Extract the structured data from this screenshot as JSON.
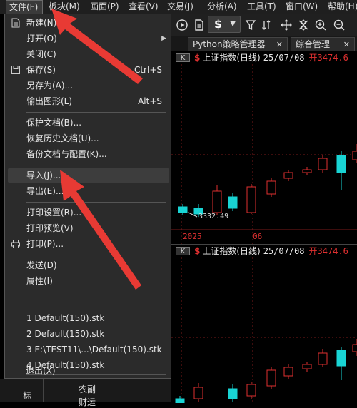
{
  "menubar": {
    "items": [
      "文件(F)",
      "板块(M)",
      "画面(P)",
      "查看(V)",
      "交易(J)",
      "分析(A)",
      "工具(T)",
      "窗口(W)",
      "帮助(H)"
    ]
  },
  "toolbar": {
    "dollar_label": "$",
    "icons": [
      "play-circle-icon",
      "document-icon",
      "chart-dollar-icon",
      "filter-icon",
      "sort-icon",
      "move-icon",
      "crossing-icon",
      "zoom-in-icon",
      "zoom-out-icon"
    ]
  },
  "tabs": [
    {
      "label": "Python策略管理器",
      "close": "✕"
    },
    {
      "label": "综合管理",
      "close": "✕"
    }
  ],
  "panes": [
    {
      "badge": "K",
      "dollar": "$",
      "title": "上证指数(日线)",
      "date": "25/07/08",
      "open_label": "开",
      "open_value": "3474.6",
      "price_label": "3332.49",
      "axis_labels": [
        "2025",
        "06"
      ]
    },
    {
      "badge": "K",
      "dollar": "$",
      "title": "上证指数(日线)",
      "date": "25/07/08",
      "open_label": "开",
      "open_value": "3474.6"
    }
  ],
  "file_menu": {
    "items": [
      {
        "label": "新建(N)",
        "shortcut": "",
        "icon": "new-document-icon"
      },
      {
        "label": "打开(O)",
        "shortcut": "",
        "submenu": true
      },
      {
        "label": "关闭(C)",
        "shortcut": ""
      },
      {
        "label": "保存(S)",
        "shortcut": "Ctrl+S",
        "icon": "save-icon"
      },
      {
        "label": "另存为(A)...",
        "shortcut": ""
      },
      {
        "label": "输出图形(L)",
        "shortcut": "Alt+S"
      },
      {
        "label": "保护文档(B)...",
        "shortcut": ""
      },
      {
        "label": "恢复历史文档(U)...",
        "shortcut": ""
      },
      {
        "label": "备份文档与配置(K)...",
        "shortcut": ""
      },
      {
        "label": "导入(J)...",
        "shortcut": "",
        "highlighted": true
      },
      {
        "label": "导出(E)...",
        "shortcut": ""
      },
      {
        "label": "打印设置(R)...",
        "shortcut": ""
      },
      {
        "label": "打印预览(V)",
        "shortcut": ""
      },
      {
        "label": "打印(P)...",
        "shortcut": "",
        "icon": "printer-icon"
      },
      {
        "label": "发送(D)",
        "shortcut": ""
      },
      {
        "label": "属性(I)",
        "shortcut": ""
      },
      {
        "label": "1 Default(150).stk",
        "shortcut": ""
      },
      {
        "label": "2 Default(150).stk",
        "shortcut": ""
      },
      {
        "label": "3 E:\\TEST11\\...\\Default(150).stk",
        "shortcut": ""
      },
      {
        "label": "4 Default(150).stk",
        "shortcut": ""
      },
      {
        "label": "退出(X)",
        "shortcut": ""
      }
    ]
  },
  "bottom_fragments": [
    "标",
    "农副",
    "财运"
  ],
  "colors": {
    "up_candle": "#e03030",
    "down_candle": "#19d4d4",
    "menu_bg": "#2b2b2b",
    "arrow": "#e83a34",
    "grid": "#7a1a1a"
  }
}
